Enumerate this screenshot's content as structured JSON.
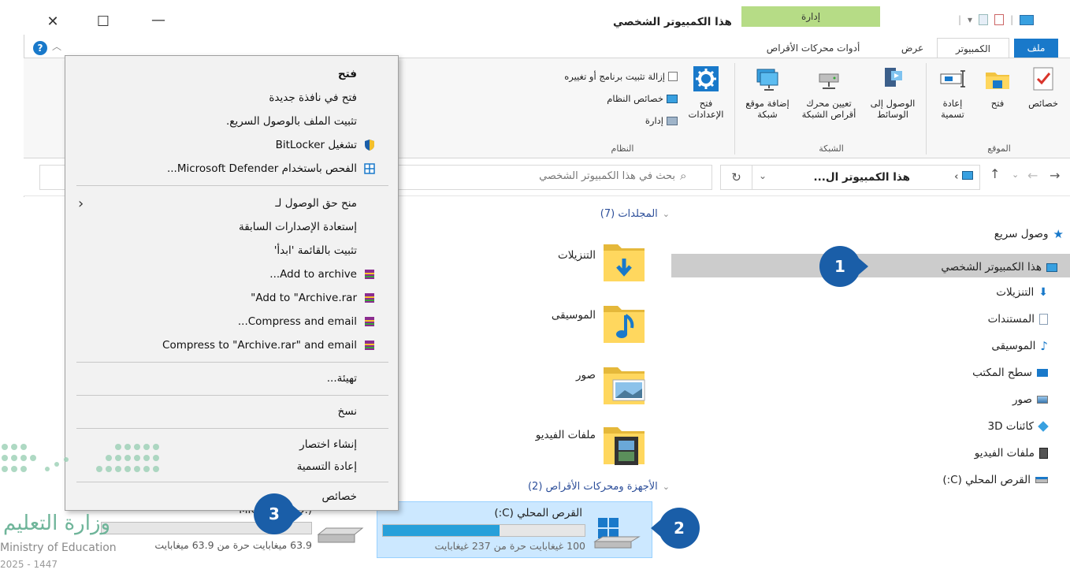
{
  "window": {
    "title": "هذا الكمبيوتر الشخصي",
    "manage_tab": "إدارة"
  },
  "ribbon": {
    "tabs": {
      "file": "ملف",
      "computer": "الكمبيوتر",
      "view": "عرض",
      "drive_tools": "أدوات محركات الأقراص"
    },
    "groups": {
      "location": {
        "label": "الموقع",
        "properties": "خصائص",
        "open": "فتح",
        "rename": "إعادة تسمية"
      },
      "network": {
        "label": "الشبكة",
        "access_media": "الوصول إلى الوسائط",
        "map_drive": "تعيين محرك أقراص الشبكة",
        "add_location": "إضافة موقع شبكة"
      },
      "system": {
        "label": "النظام",
        "open_settings": "فتح الإعدادات",
        "uninstall": "إزالة تثبيت برنامج أو تغييره",
        "system_properties": "خصائص النظام",
        "manage": "إدارة"
      }
    }
  },
  "addressbar": {
    "path": "هذا الكمبيوتر ال...",
    "search_placeholder": "بحث في هذا الكمبيوتر الشخصي"
  },
  "nav_pane": {
    "items": [
      {
        "label": "وصول سريع",
        "icon": "star-icon"
      },
      {
        "label": "هذا الكمبيوتر الشخصي",
        "icon": "computer-icon",
        "selected": true
      },
      {
        "label": "التنزيلات",
        "icon": "download-icon"
      },
      {
        "label": "المستندات",
        "icon": "documents-icon"
      },
      {
        "label": "الموسيقى",
        "icon": "music-icon"
      },
      {
        "label": "سطح المكتب",
        "icon": "desktop-icon"
      },
      {
        "label": "صور",
        "icon": "pictures-icon"
      },
      {
        "label": "كائنات 3D",
        "icon": "3d-objects-icon"
      },
      {
        "label": "ملفات الفيديو",
        "icon": "video-icon"
      },
      {
        "label": "القرص المحلي (C:)",
        "icon": "drive-icon"
      }
    ]
  },
  "content": {
    "folders_header": "المجلدات (7)",
    "folders": [
      {
        "label": "التنزيلات"
      },
      {
        "label": "الموسيقى"
      },
      {
        "label": "صور"
      },
      {
        "label": "ملفات الفيديو"
      }
    ],
    "devices_header": "الأجهزة ومحركات الأقراص (2)",
    "drive_c": {
      "label": "القرص المحلي (C:)",
      "free_text": "100 غيغابايت حرة من 237 غيغابايت",
      "used_fraction": 0.58
    },
    "drive_d": {
      "label": "MICROBIT (D:)",
      "free_text": "63.9 ميغابايت حرة من 63.9 ميغابايت",
      "used_fraction": 0.0
    }
  },
  "context_menu": {
    "items": {
      "open": "فتح",
      "open_new_window": "فتح في نافذة جديدة",
      "pin_quick_access": "تثبيت الملف بالوصول السريع.",
      "bitlocker": "تشغيل BitLocker",
      "defender": "الفحص باستخدام Microsoft Defender...",
      "give_access": "منح حق الوصول لـ",
      "restore_versions": "إستعادة الإصدارات السابقة",
      "pin_start": "تثبيت بالقائمة 'ابدأ'",
      "add_archive": "...Add to archive",
      "add_archive_rar": "\"Add to \"Archive.rar",
      "compress_email": "...Compress and email",
      "compress_rar_email": "Compress to \"Archive.rar\" and email",
      "format": "تهيئة...",
      "copy": "نسخ",
      "create_shortcut": "إنشاء اختصار",
      "rename": "إعادة التسمية",
      "properties": "خصائص"
    }
  },
  "badges": {
    "one": "1",
    "two": "2",
    "three": "3"
  },
  "watermark": {
    "arabic": "وزارة التعليم",
    "english": "Ministry of Education",
    "year": "2025 - 1447"
  },
  "colors": {
    "accent": "#1979ca",
    "badge": "#1a5ea8",
    "manage_tab": "#b6dc86",
    "selection": "#cce8ff",
    "progress": "#26a0da"
  }
}
